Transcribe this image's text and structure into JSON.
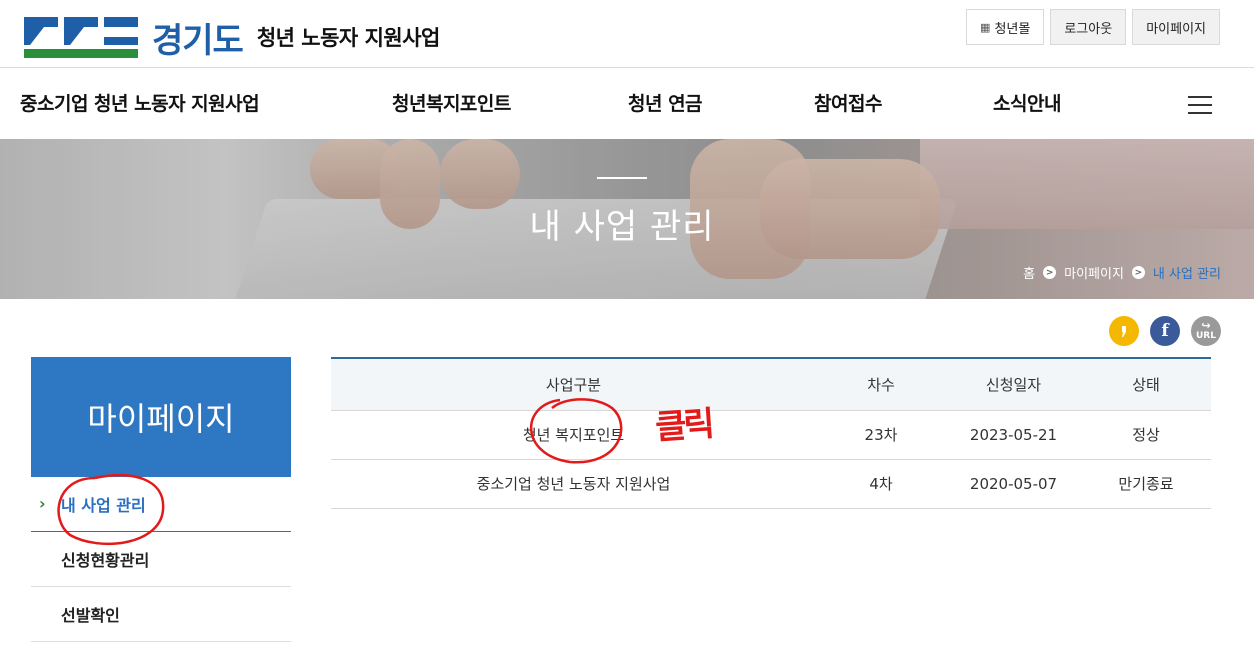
{
  "brand": {
    "name": "경기도",
    "subtitle": "청년 노동자 지원사업",
    "colors": {
      "blue": "#1f5fa8",
      "green": "#2a8f3b"
    }
  },
  "top_buttons": [
    {
      "label": "청년몰",
      "icon": "store-icon"
    },
    {
      "label": "로그아웃"
    },
    {
      "label": "마이페이지"
    }
  ],
  "nav": {
    "items": [
      "중소기업 청년 노동자 지원사업",
      "청년복지포인트",
      "청년 연금",
      "참여접수",
      "소식안내"
    ],
    "menu_icon": "hamburger-icon"
  },
  "banner": {
    "title": "내 사업 관리"
  },
  "breadcrumb": {
    "home": "홈",
    "level1": "마이페이지",
    "current": "내 사업 관리"
  },
  "share": {
    "kakao": "kakao-icon",
    "facebook": "f",
    "url": "URL"
  },
  "sidebar": {
    "title": "마이페이지",
    "items": [
      {
        "label": "내 사업 관리",
        "active": true
      },
      {
        "label": "신청현황관리"
      },
      {
        "label": "선발확인"
      }
    ]
  },
  "table": {
    "headers": [
      "사업구분",
      "차수",
      "신청일자",
      "상태"
    ],
    "rows": [
      [
        "청년 복지포인트",
        "23차",
        "2023-05-21",
        "정상"
      ],
      [
        "중소기업 청년 노동자 지원사업",
        "4차",
        "2020-05-07",
        "만기종료"
      ]
    ]
  },
  "annotation": {
    "text": "클릭",
    "color": "#e21a1a"
  }
}
